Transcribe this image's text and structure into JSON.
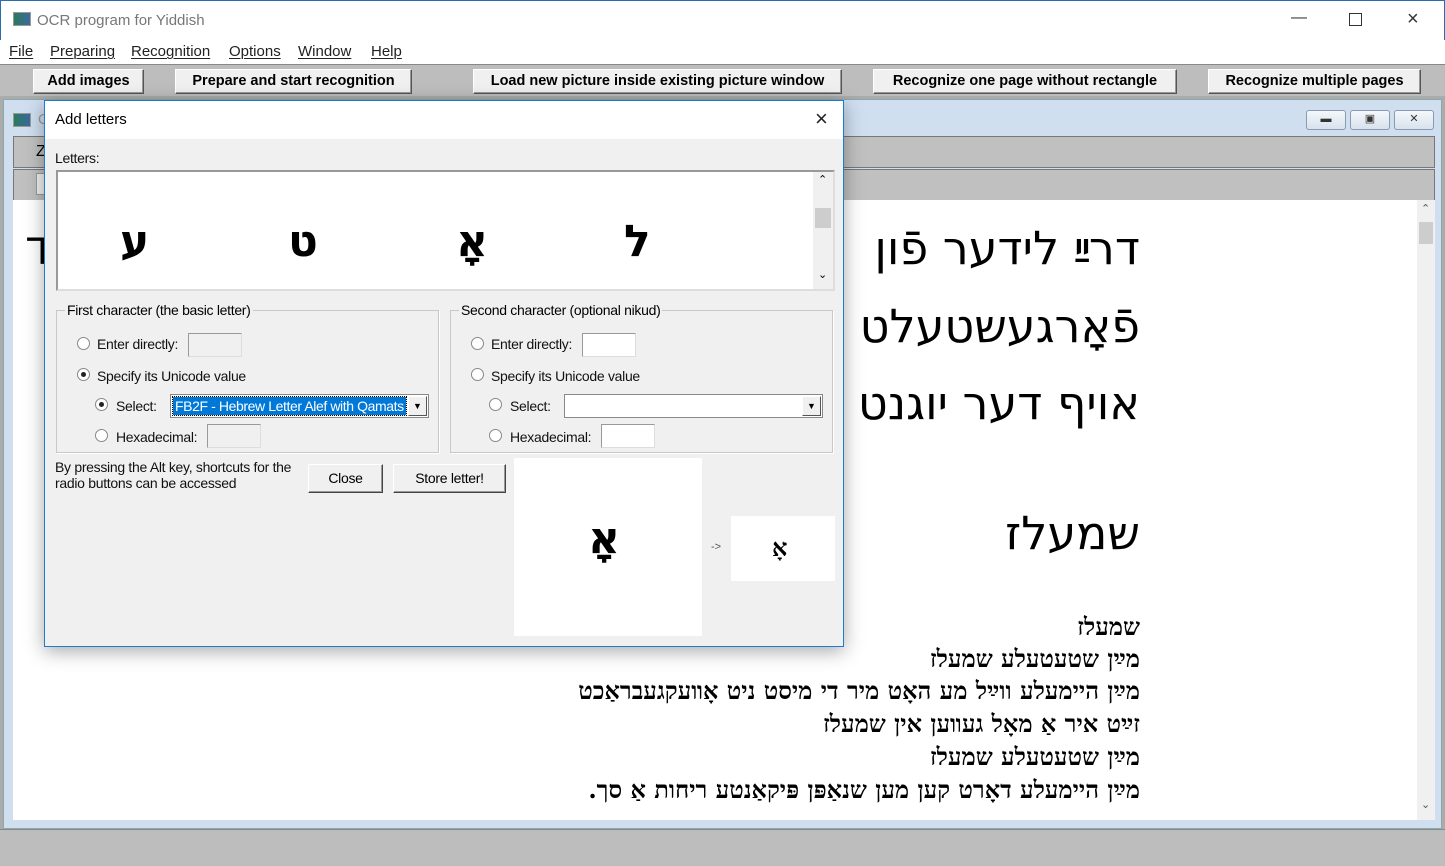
{
  "app": {
    "title": "OCR program for Yiddish"
  },
  "menu": [
    "File",
    "Preparing",
    "Recognition",
    "Options",
    "Window",
    "Help"
  ],
  "toolbar": [
    "Add images",
    "Prepare and start recognition",
    "Load new picture inside existing picture window",
    "Recognize one page without rectangle",
    "Recognize multiple pages"
  ],
  "child_window": {
    "title_partial": "O",
    "toolbar_partial": "Z"
  },
  "document": {
    "big_lines": [
      "דרײַ לידער פֿון",
      "פֿאָרגעשטעלט",
      "אויף דער יוגנט",
      "שמעלז"
    ],
    "left_partial": "ד",
    "small_lines": [
      "שמעלז",
      "מײַן שטעטעלע שמעלז",
      "מײַן היימעלע ווײַל מע האָט מיר די מיסט ניט אָװעקגעבראַכט",
      "זײַט איר אַ מאָל געװען אין שמעלז",
      "מײַן שטעטעלע שמעלז",
      "מײַן היימעלע דאָרט קען מען שנאַפּן פּיקאַנטע ריחות אַ סך."
    ]
  },
  "dialog": {
    "title": "Add letters",
    "letters_label": "Letters:",
    "letters": [
      "ע",
      "ט",
      "אָ",
      "ל"
    ],
    "first_group": {
      "title": "First character (the basic letter)",
      "enter_directly": "Enter directly:",
      "specify_unicode": "Specify its Unicode value",
      "select": "Select:",
      "select_value": "FB2F - Hebrew Letter Alef with Qamats",
      "hexadecimal": "Hexadecimal:",
      "selected_mode": "unicode-select"
    },
    "second_group": {
      "title": "Second character (optional nikud)",
      "enter_directly": "Enter directly:",
      "specify_unicode": "Specify its Unicode value",
      "select": "Select:",
      "select_value": "",
      "hexadecimal": "Hexadecimal:"
    },
    "hint": "By pressing the Alt key, shortcuts for the radio buttons can be accessed",
    "close": "Close",
    "store": "Store letter!",
    "preview_glyph": "אָ",
    "arrow": "->",
    "result_glyph": "אָ"
  }
}
